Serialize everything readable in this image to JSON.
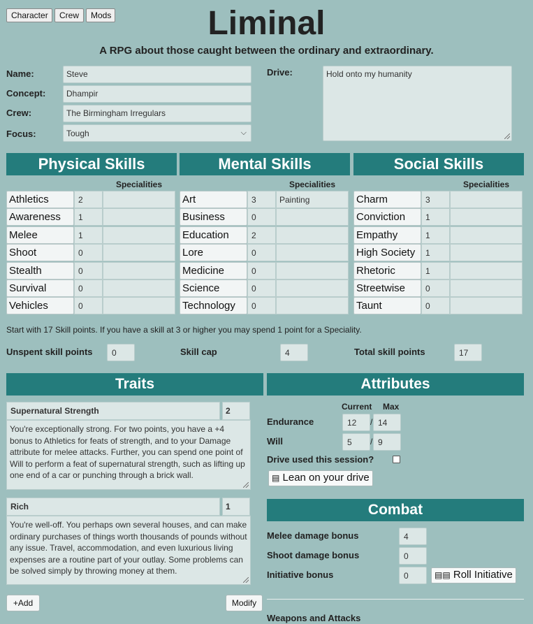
{
  "nav": {
    "tabs": [
      "Character",
      "Crew",
      "Mods"
    ]
  },
  "header": {
    "title": "Liminal",
    "subtitle": "A RPG about those caught between the ordinary and extraordinary."
  },
  "character": {
    "name_label": "Name:",
    "name": "Steve",
    "concept_label": "Concept:",
    "concept": "Dhampir",
    "crew_label": "Crew:",
    "crew": "The Birmingham Irregulars",
    "focus_label": "Focus:",
    "focus": "Tough",
    "drive_label": "Drive:",
    "drive": "Hold onto my humanity"
  },
  "skills": {
    "specialities_label": "Specialities",
    "groups": [
      {
        "title": "Physical Skills",
        "items": [
          {
            "name": "Athletics",
            "value": "2",
            "spec": ""
          },
          {
            "name": "Awareness",
            "value": "1",
            "spec": ""
          },
          {
            "name": "Melee",
            "value": "1",
            "spec": ""
          },
          {
            "name": "Shoot",
            "value": "0",
            "spec": ""
          },
          {
            "name": "Stealth",
            "value": "0",
            "spec": ""
          },
          {
            "name": "Survival",
            "value": "0",
            "spec": ""
          },
          {
            "name": "Vehicles",
            "value": "0",
            "spec": ""
          }
        ]
      },
      {
        "title": "Mental Skills",
        "items": [
          {
            "name": "Art",
            "value": "3",
            "spec": "Painting"
          },
          {
            "name": "Business",
            "value": "0",
            "spec": ""
          },
          {
            "name": "Education",
            "value": "2",
            "spec": ""
          },
          {
            "name": "Lore",
            "value": "0",
            "spec": ""
          },
          {
            "name": "Medicine",
            "value": "0",
            "spec": ""
          },
          {
            "name": "Science",
            "value": "0",
            "spec": ""
          },
          {
            "name": "Technology",
            "value": "0",
            "spec": ""
          }
        ]
      },
      {
        "title": "Social Skills",
        "items": [
          {
            "name": "Charm",
            "value": "3",
            "spec": ""
          },
          {
            "name": "Conviction",
            "value": "1",
            "spec": ""
          },
          {
            "name": "Empathy",
            "value": "1",
            "spec": ""
          },
          {
            "name": "High Society",
            "value": "1",
            "spec": ""
          },
          {
            "name": "Rhetoric",
            "value": "1",
            "spec": ""
          },
          {
            "name": "Streetwise",
            "value": "0",
            "spec": ""
          },
          {
            "name": "Taunt",
            "value": "0",
            "spec": ""
          }
        ]
      }
    ],
    "note": "Start with 17 Skill points. If you have a skill at 3 or higher you may spend 1 point for a Speciality.",
    "unspent_label": "Unspent skill points",
    "unspent": "0",
    "cap_label": "Skill cap",
    "cap": "4",
    "total_label": "Total skill points",
    "total": "17"
  },
  "traits": {
    "title": "Traits",
    "items": [
      {
        "name": "Supernatural Strength",
        "cost": "2",
        "description": "You're exceptionally strong. For two points, you have a +4 bonus to Athletics for feats of strength, and to your Damage attribute for melee attacks. Further, you can spend one point of Will to perform a feat of supernatural strength, such as lifting up one end of a car or punching through a brick wall."
      },
      {
        "name": "Rich",
        "cost": "1",
        "description": "You're well-off. You perhaps own several houses, and can make ordinary purchases of things worth thousands of pounds without any issue. Travel, accommodation, and even luxurious living expenses are a routine part of your outlay. Some problems can be solved simply by throwing money at them."
      }
    ],
    "add_label": "+Add",
    "modify_label": "Modify"
  },
  "attributes": {
    "title": "Attributes",
    "current_label": "Current",
    "max_label": "Max",
    "endurance_label": "Endurance",
    "endurance_current": "12",
    "endurance_max": "14",
    "will_label": "Will",
    "will_current": "5",
    "will_max": "9",
    "slash": "/",
    "drive_used_label": "Drive used this session?",
    "lean_label": "Lean on your drive"
  },
  "combat": {
    "title": "Combat",
    "melee_label": "Melee damage bonus",
    "melee": "4",
    "shoot_label": "Shoot damage bonus",
    "shoot": "0",
    "initiative_label": "Initiative bonus",
    "initiative": "0",
    "roll_label": "Roll Initiative",
    "weapons_label": "Weapons and Attacks"
  },
  "icons": {
    "dice": "dice-icon",
    "chevron": "chevron-down-icon"
  },
  "colors": {
    "background": "#9dbfbe",
    "header": "#247c7c",
    "field": "#dce7e6"
  }
}
